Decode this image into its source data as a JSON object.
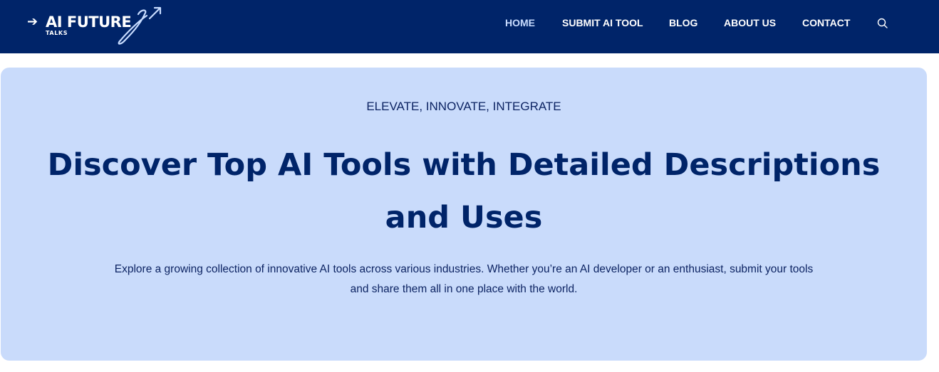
{
  "brand": {
    "arrow_glyph": "➔",
    "name": "AI FUTURE",
    "tagline": "TALKS"
  },
  "nav": {
    "items": [
      {
        "label": "HOME",
        "active": true
      },
      {
        "label": "SUBMIT AI TOOL",
        "active": false
      },
      {
        "label": "BLOG",
        "active": false
      },
      {
        "label": "ABOUT US",
        "active": false
      },
      {
        "label": "CONTACT",
        "active": false
      }
    ],
    "search_icon": "search-icon"
  },
  "hero": {
    "eyebrow": "ELEVATE, INNOVATE, INTEGRATE",
    "headline_line1": "Discover Top AI Tools with Detailed Descriptions",
    "headline_line2": "and Uses",
    "description_line1": "Explore a growing collection of innovative AI tools across various industries. Whether you’re an AI developer or an enthusiast, submit your tools",
    "description_line2": "and share them all in one place with the world."
  },
  "colors": {
    "header_bg": "#002469",
    "hero_bg": "#c9dbfb",
    "headline": "#002469",
    "nav_active": "#c8dcff",
    "nav_text": "#ffffff"
  }
}
